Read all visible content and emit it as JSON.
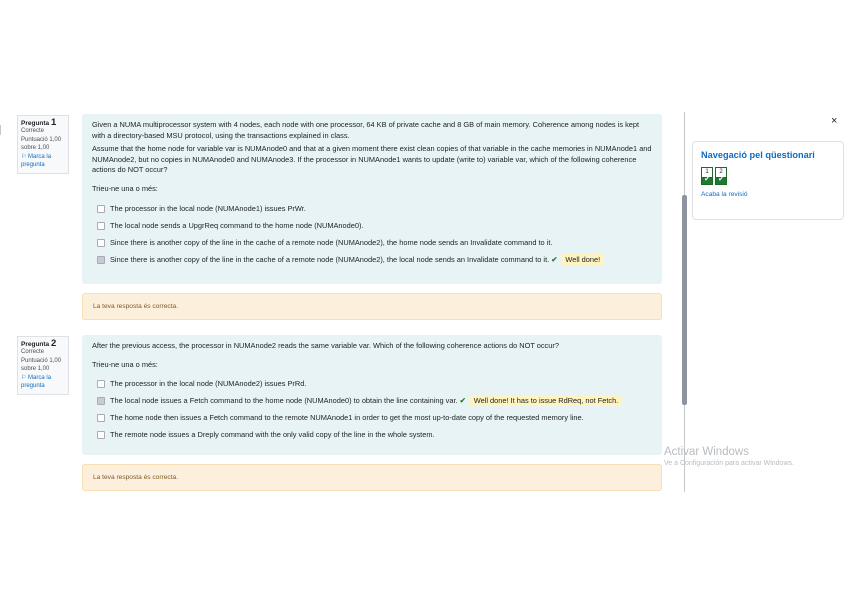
{
  "questions": [
    {
      "label": "Pregunta",
      "number": "1",
      "status": "Correcte",
      "score": "Puntuació 1,00 sobre 1,00",
      "flag": "Marca la pregunta",
      "text1": "Given a NUMA multiprocessor system with 4 nodes, each node with one processor, 64 KB of private cache and 8 GB of main memory. Coherence among nodes is kept with a directory-based MSU protocol, using the transactions explained in class.",
      "text2": "Assume that the home node for variable var is NUMAnode0 and that at a given moment there exist clean copies of that variable in the cache memories in NUMAnode1 and NUMAnode2, but no copies in NUMAnode0 and NUMAnode3. If the processor in NUMAnode1 wants to update (write to) variable var, which of the following coherence actions do NOT occur?",
      "prompt": "Trieu-ne una o més:",
      "options": [
        {
          "text": "The processor in the local node (NUMAnode1) issues PrWr.",
          "checked": false,
          "feedback": ""
        },
        {
          "text": "The local node sends a UpgrReq command to the home node (NUMAnode0).",
          "checked": false,
          "feedback": ""
        },
        {
          "text": "Since there is another copy of the line in the cache of a remote node (NUMAnode2), the home node sends an Invalidate command to it.",
          "checked": false,
          "feedback": ""
        },
        {
          "text": "Since there is another copy of the line in the cache of a remote node (NUMAnode2), the local node sends an Invalidate command to it.",
          "checked": true,
          "feedback": "Well done!"
        }
      ],
      "outcome": "La teva resposta és correcta."
    },
    {
      "label": "Pregunta",
      "number": "2",
      "status": "Correcte",
      "score": "Puntuació 1,00 sobre 1,00",
      "flag": "Marca la pregunta",
      "text1": "After the previous access, the processor in NUMAnode2 reads the same variable var. Which of the following coherence actions do NOT occur?",
      "text2": "",
      "prompt": "Trieu-ne una o més:",
      "options": [
        {
          "text": "The processor in the local node (NUMAnode2) issues PrRd.",
          "checked": false,
          "feedback": ""
        },
        {
          "text": "The local node issues a Fetch command to the home node (NUMAnode0) to obtain the line containing var.",
          "checked": true,
          "feedback": "Well done! It has to issue RdReq, not Fetch."
        },
        {
          "text": "The home node then issues a Fetch command to the remote NUMAnode1 in order to get the most up-to-date copy of the requested memory line.",
          "checked": false,
          "feedback": ""
        },
        {
          "text": "The remote node issues a Dreply command with the only valid copy of the line in the whole system.",
          "checked": false,
          "feedback": ""
        }
      ],
      "outcome": "La teva resposta és correcta."
    }
  ],
  "nav": {
    "close": "×",
    "title": "Navegació pel qüestionari",
    "buttons": [
      "1",
      "2"
    ],
    "finish": "Acaba la revisió"
  },
  "watermark": {
    "line1": "Activar Windows",
    "line2": "Ve a Configuración para activar Windows."
  },
  "colors": {
    "correct": "#357a32",
    "link": "#0f6cbf",
    "content_bg": "#e7f3f5",
    "outcome_bg": "#fcefdc",
    "feedback_bg": "#fff3bf"
  }
}
